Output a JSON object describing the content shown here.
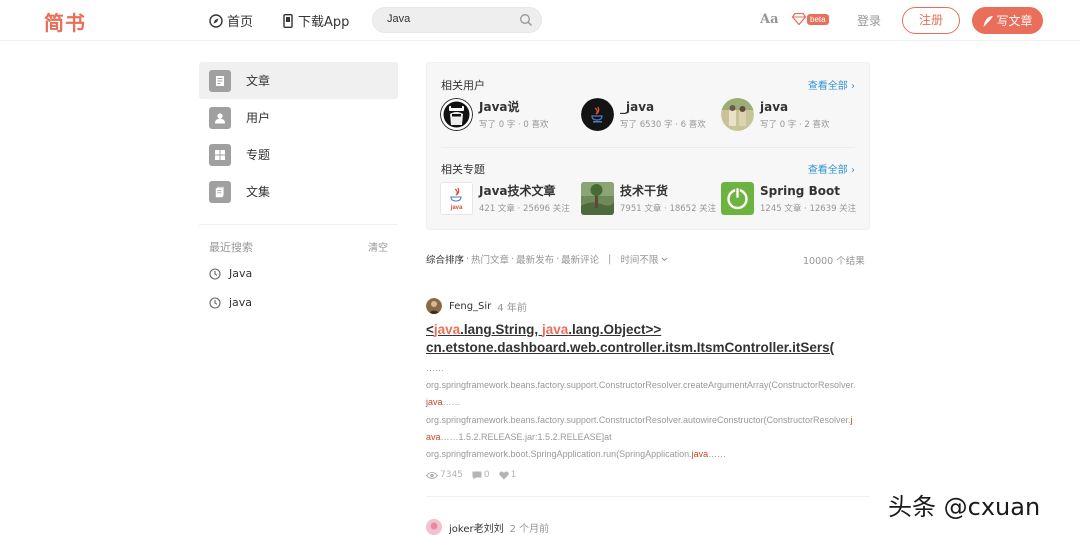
{
  "header": {
    "logo": "简书",
    "nav": [
      {
        "label": "首页",
        "icon": "compass-icon"
      },
      {
        "label": "下载App",
        "icon": "phone-icon"
      }
    ],
    "search": {
      "value": "Java",
      "placeholder": "搜索"
    },
    "aa_label": "Aa",
    "beta_label": "beta",
    "login_label": "登录",
    "signup_label": "注册",
    "write_label": "写文章",
    "accent_color": "#ea6f5a"
  },
  "sidebar": {
    "items": [
      {
        "label": "文章",
        "icon": "article-icon",
        "active": true
      },
      {
        "label": "用户",
        "icon": "user-icon",
        "active": false
      },
      {
        "label": "专题",
        "icon": "collection-icon",
        "active": false
      },
      {
        "label": "文集",
        "icon": "notebook-icon",
        "active": false
      }
    ],
    "recent": {
      "title": "最近搜索",
      "clear_label": "清空",
      "items": [
        "Java",
        "java"
      ]
    }
  },
  "related": {
    "users_title": "相关用户",
    "users_more": "查看全部 ›",
    "users": [
      {
        "name": "Java说",
        "meta": "写了 0 字 · 0 喜欢"
      },
      {
        "name": "_java",
        "meta": "写了 6530 字 · 6 喜欢"
      },
      {
        "name": "java",
        "meta": "写了 0 字 · 2 喜欢"
      }
    ],
    "topics_title": "相关专题",
    "topics_more": "查看全部 ›",
    "topics": [
      {
        "name": "Java技术文章",
        "meta": "421 文章 · 25696 关注"
      },
      {
        "name": "技术干货",
        "meta": "7951 文章 · 18652 关注"
      },
      {
        "name": "Spring Boot",
        "meta": "1245 文章 · 12639 关注"
      }
    ]
  },
  "sort": {
    "options": [
      "综合排序",
      "热门文章",
      "最新发布",
      "最新评论"
    ],
    "time_filter": "时间不限",
    "result_count": "10000 个结果"
  },
  "articles": [
    {
      "author": "Feng_Sir",
      "time": "4 年前",
      "title_line1": [
        "<",
        "java",
        ".lang.String, ",
        "java",
        ".lang.Object>>"
      ],
      "title_line2": "cn.etstone.dashboard.web.controller.itsm.ItsmController.itSers(",
      "abstract": {
        "l0": "……",
        "l1": "org.springframework.beans.factory.support.ConstructorResolver.createArgumentArray(ConstructorResolver.",
        "l2hl": "java",
        "l2": "……",
        "l3": "org.springframework.beans.factory.support.ConstructorResolver.autowireConstructor(ConstructorResolver.",
        "l3hl": "j",
        "l4hl": "ava",
        "l4": "……1.5.2.RELEASE.jar:1.5.2.RELEASE]at",
        "l5": "org.springframework.boot.SpringApplication.run(SpringApplication.",
        "l5hl": "java",
        "l5tail": "……"
      },
      "views": "7345",
      "comments": "0",
      "likes": "1"
    },
    {
      "author": "joker老刘刘",
      "time": "2 个月前"
    }
  ],
  "watermark": "头条 @cxuan"
}
